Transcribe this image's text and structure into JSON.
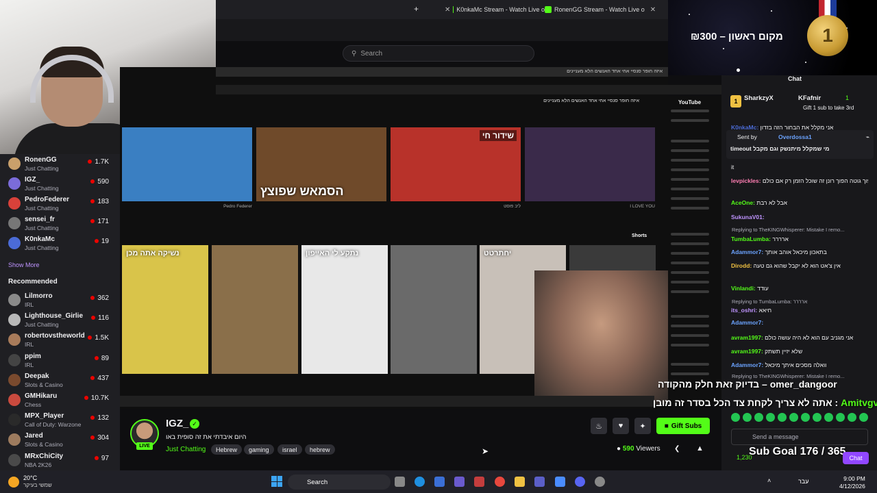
{
  "browser": {
    "tabs": [
      {
        "label": "K0nkaMc Stream - Watch Live o"
      },
      {
        "label": "RonenGG Stream - Watch Live o"
      }
    ],
    "new_tab": "+",
    "close": "✕"
  },
  "search": {
    "placeholder": "Search"
  },
  "sidebar": {
    "following": [
      {
        "name": "RonenGG",
        "game": "Just Chatting",
        "viewers": "1.7K",
        "color": "#c9a06b"
      },
      {
        "name": "IGZ_",
        "game": "Just Chatting",
        "viewers": "590",
        "color": "#7b6cd9"
      },
      {
        "name": "PedroFederer",
        "game": "Just Chatting",
        "viewers": "183",
        "color": "#d9413a"
      },
      {
        "name": "sensei_fr",
        "game": "Just Chatting",
        "viewers": "171",
        "color": "#777777"
      },
      {
        "name": "K0nkaMc",
        "game": "Just Chatting",
        "viewers": "19",
        "color": "#4b6bd6"
      }
    ],
    "show_more": "Show More",
    "recommended_title": "Recommended",
    "recommended": [
      {
        "name": "Lilmorro",
        "game": "IRL",
        "viewers": "362",
        "color": "#8a8a8a"
      },
      {
        "name": "Lighthouse_Girlie",
        "game": "Just Chatting",
        "viewers": "116",
        "color": "#b8b8b8"
      },
      {
        "name": "robertovstheworld",
        "game": "IRL",
        "viewers": "1.5K",
        "color": "#a87b5a"
      },
      {
        "name": "ppim",
        "game": "IRL",
        "viewers": "89",
        "color": "#444444"
      },
      {
        "name": "Deepak",
        "game": "Slots & Casino",
        "viewers": "437",
        "color": "#7a4a2e"
      },
      {
        "name": "GMHikaru",
        "game": "Chess",
        "viewers": "10.7K",
        "color": "#c94a3e"
      },
      {
        "name": "MPX_Player",
        "game": "Call of Duty: Warzone",
        "viewers": "132",
        "color": "#2a2a2a"
      },
      {
        "name": "Jared",
        "game": "Slots & Casino",
        "viewers": "304",
        "color": "#9d7b5e"
      },
      {
        "name": "MRxChiCity",
        "game": "NBA 2K26",
        "viewers": "97",
        "color": "#4a4a4a"
      }
    ]
  },
  "video": {
    "yt_title": "איזה חופר סנסיי אחי אחד האנשים הלא מעניינים",
    "yt_logo": "YouTube",
    "shorts_label": "Shorts",
    "thumbs": [
      {
        "caption": "",
        "live": "",
        "color": "#3a7fc2",
        "meta": "Pedro Federer"
      },
      {
        "caption": "הסמאש שפוצץ",
        "live": "",
        "color": "#6f4a2a",
        "meta": ""
      },
      {
        "caption": "",
        "live": "שידור חי",
        "color": "#b8322a",
        "meta": "ליב פוסט"
      },
      {
        "caption": "",
        "live": "",
        "color": "#3a2a4a",
        "meta": "I LOVE YOU"
      }
    ],
    "shorts": [
      {
        "caption": "נשיקה אתה מכן",
        "color": "#d9c44a"
      },
      {
        "caption": "",
        "color": "#8a6f4a"
      },
      {
        "caption": "נתקע לי האייפון",
        "color": "#e8e8e8"
      },
      {
        "caption": "",
        "color": "#6a6a6a"
      },
      {
        "caption": "יחתרטט",
        "color": "#c8c0b8"
      },
      {
        "caption": "",
        "color": "#3a3a3a"
      }
    ]
  },
  "gift_banner": {
    "text": "מקום ראשון – ₪300",
    "medal": "1"
  },
  "chat": {
    "title": "Chat",
    "leaders": [
      {
        "name": "SharkzyX",
        "rank": "1"
      },
      {
        "name": "KFafnir",
        "rank": "1"
      }
    ],
    "gift_note": "Gift 1 sub to take 3rd",
    "pinned_by": "Sent by",
    "pinned_user": "Overdossa1",
    "pinned_text": "מי שמקלל מיתנשק וגם מקבל timeout",
    "messages": [
      {
        "user": "K0nkaMc:",
        "text": "אני מקלל את הבחור הזה בזדון",
        "color": "#4b6bd6"
      },
      {
        "user": "",
        "text": "it",
        "color": "#efeff1"
      },
      {
        "user": "levpickles:",
        "text": "הפוך גוטה הפוך רונן זה שוכל הזמן רק אם כולם",
        "color": "#ff7eb3"
      },
      {
        "user": "AceOne:",
        "text": "אבל לא רבת",
        "color": "#53fc18"
      },
      {
        "user": "SukunaV01:",
        "text": "",
        "color": "#bf94ff"
      },
      {
        "user": "TumbaLumba:",
        "text": "ארררר",
        "color": "#53fc18"
      },
      {
        "user": "Adammor7:",
        "text": "בתאכון מיכאל אוהב אותך",
        "color": "#6ba3ff"
      },
      {
        "user": "Dirodd:",
        "text": "אין צ'אט הוא לא יקבל שהוא גם טעה",
        "color": "#f0c142"
      },
      {
        "user": "Vinlandi:",
        "text": "עודד",
        "color": "#53fc18"
      },
      {
        "user": "its_oshri:",
        "text": "חיאא",
        "color": "#bf94ff"
      },
      {
        "user": "Adammor7:",
        "text": "",
        "color": "#6ba3ff"
      },
      {
        "user": "avram1997:",
        "text": "אני מגניב עם הוא לא היה עושה כולם",
        "color": "#53fc18"
      },
      {
        "user": "avram1997:",
        "text": "שלא יזיין תשתק",
        "color": "#53fc18"
      },
      {
        "user": "Adammor7:",
        "text": "וואלה מסכים איתך מיכאל",
        "color": "#6ba3ff"
      }
    ],
    "replies": [
      {
        "text": "Replying to TheKINGWhisperer: Mistake I remo..."
      },
      {
        "text": "Replying to TumbaLumba: ארררר"
      },
      {
        "text": "Replying to TheKINGWhisperer: Mistake I remo..."
      }
    ],
    "input_placeholder": "Send a message",
    "chat_button": "Chat",
    "sub_goal": "Sub Goal 176 / 365",
    "points": "1,230"
  },
  "alerts": {
    "alert1_user": "omer_dangoor",
    "alert1_text": "בדיוק זאת חלק מהקודה –",
    "alert2_user": "Amitvgvg",
    "alert2_text": "אתה לא צריך לקחת צד הכל בסדר זה מובן"
  },
  "stream_info": {
    "streamer": "IGZ_",
    "title": "היום איבדתי את זה סופית באו",
    "category": "Just Chatting",
    "tags": [
      "Hebrew",
      "gaming",
      "israel",
      "hebrew"
    ],
    "live": "LIVE",
    "gift_subs": "Gift Subs",
    "viewers": "590",
    "viewers_label": "Viewers"
  },
  "taskbar": {
    "temperature": "20°C",
    "weather_desc": "שמשי בעיקר",
    "search": "Search",
    "lang": "עבר",
    "time": "9:00 PM",
    "date": "4/12/2026"
  },
  "colors": {
    "accent": "#53fc18",
    "bg": "#0e0e10",
    "panel": "#18181b"
  }
}
